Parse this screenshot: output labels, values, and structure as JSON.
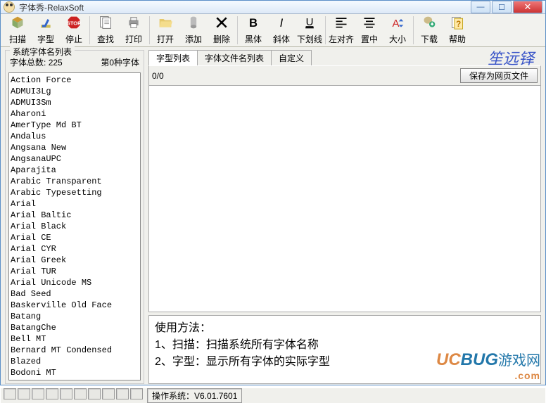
{
  "title": "字体秀-RelaxSoft",
  "winbtns": {
    "min": "—",
    "max": "☐",
    "close": "✕"
  },
  "toolbar": [
    {
      "name": "scan-button",
      "label": "扫描",
      "icon": "scan"
    },
    {
      "name": "fonttype-button",
      "label": "字型",
      "icon": "fonttype"
    },
    {
      "name": "stop-button",
      "label": "停止",
      "icon": "stop"
    },
    {
      "sep": true
    },
    {
      "name": "find-button",
      "label": "查找",
      "icon": "find"
    },
    {
      "name": "print-button",
      "label": "打印",
      "icon": "print"
    },
    {
      "sep": true
    },
    {
      "name": "open-button",
      "label": "打开",
      "icon": "open"
    },
    {
      "name": "add-button",
      "label": "添加",
      "icon": "add"
    },
    {
      "name": "delete-button",
      "label": "删除",
      "icon": "delete"
    },
    {
      "sep": true
    },
    {
      "name": "bold-button",
      "label": "黑体",
      "icon": "bold"
    },
    {
      "name": "italic-button",
      "label": "斜体",
      "icon": "italic"
    },
    {
      "name": "underline-button",
      "label": "下划线",
      "icon": "underline"
    },
    {
      "sep": true
    },
    {
      "name": "align-left-button",
      "label": "左对齐",
      "icon": "alignl"
    },
    {
      "name": "align-center-button",
      "label": "置中",
      "icon": "alignc"
    },
    {
      "name": "size-button",
      "label": "大小",
      "icon": "size"
    },
    {
      "sep": true
    },
    {
      "name": "download-button",
      "label": "下载",
      "icon": "download"
    },
    {
      "name": "help-button",
      "label": "帮助",
      "icon": "help"
    }
  ],
  "sidebar": {
    "legend": "系统字体名列表",
    "total_label": "字体总数:",
    "total_value": "225",
    "nth_label": "第0种字体",
    "fonts": [
      "Action Force",
      "ADMUI3Lg",
      "ADMUI3Sm",
      "Aharoni",
      "AmerType Md BT",
      "Andalus",
      "Angsana New",
      "AngsanaUPC",
      "Aparajita",
      "Arabic Transparent",
      "Arabic Typesetting",
      "Arial",
      "Arial Baltic",
      "Arial Black",
      "Arial CE",
      "Arial CYR",
      "Arial Greek",
      "Arial TUR",
      "Arial Unicode MS",
      "Bad Seed",
      "Baskerville Old Face",
      "Batang",
      "BatangChe",
      "Bell MT",
      "Bernard MT Condensed",
      "Blazed",
      "Bodoni MT"
    ]
  },
  "tabs": [
    {
      "name": "tab-fonttype-list",
      "label": "字型列表",
      "active": true
    },
    {
      "name": "tab-fontfile-list",
      "label": "字体文件名列表",
      "active": false
    },
    {
      "name": "tab-custom",
      "label": "自定义",
      "active": false
    }
  ],
  "signature": "笙远铎",
  "counter": "0/0",
  "save_btn": "保存为网页文件",
  "instructions": {
    "title": "使用方法：",
    "line1": "1、扫描：扫描系统所有字体名称",
    "line2": "2、字型：显示所有字体的实际字型"
  },
  "status": {
    "os_label": "操作系统：",
    "os_value": "V6.01.7601"
  },
  "watermark": {
    "part1": "UC",
    "part2": "BUG",
    "cn": "游戏网",
    "com": ".com"
  }
}
